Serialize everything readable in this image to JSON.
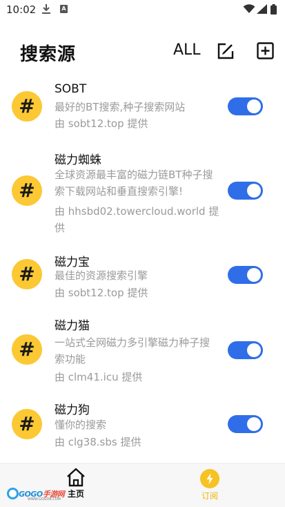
{
  "statusbar": {
    "time": "10:02",
    "icons": [
      "download-icon",
      "a-notification-icon",
      "wifi-icon",
      "signal-icon",
      "battery-icon"
    ]
  },
  "header": {
    "title": "搜索源",
    "all_label": "ALL",
    "edit_icon": "edit-icon",
    "add_icon": "add-box-icon"
  },
  "sources": [
    {
      "name": "SOBT",
      "description": "最好的BT搜索,种子搜索网站",
      "provider": "由 sobt12.top 提供",
      "enabled": true
    },
    {
      "name": "磁力蜘蛛",
      "description": "全球资源最丰富的磁力链BT种子搜索下载网站和垂直搜索引擎!",
      "provider": "由 hhsbd02.towercloud.world 提供",
      "enabled": true
    },
    {
      "name": "磁力宝",
      "description": "最佳的资源搜索引擎",
      "provider": "由 sobt12.top 提供",
      "enabled": true
    },
    {
      "name": "磁力猫",
      "description": "一站式全网磁力多引擎磁力种子搜索功能",
      "provider": "由 clm41.icu 提供",
      "enabled": true
    },
    {
      "name": "磁力狗",
      "description": "懂你的搜索",
      "provider": "由 clg38.sbs 提供",
      "enabled": true
    }
  ],
  "source_icon_glyph": "#",
  "bottom_nav": {
    "home_label": "主页",
    "subscribe_label": "订阅",
    "active": "subscribe"
  },
  "watermark": {
    "text_blue": "GOGO",
    "text_red": "手游网",
    "sub": "WWW.GOGO8.COM"
  },
  "colors": {
    "accent": "#2f6ee8",
    "icon_bg": "#fcc833",
    "active_tab": "#f0b400"
  }
}
